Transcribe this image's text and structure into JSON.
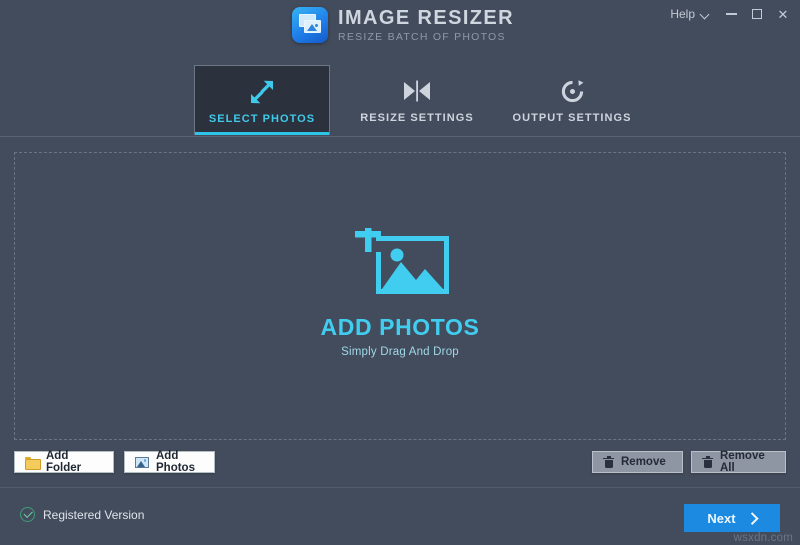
{
  "window": {
    "app_title": "IMAGE RESIZER",
    "app_subtitle": "RESIZE BATCH OF PHOTOS",
    "logo_icon": "image-stack-icon",
    "help_label": "Help",
    "help_chevron_icon": "chevron-down-icon",
    "minimize_icon": "minimize-icon",
    "maximize_icon": "maximize-icon",
    "close_icon": "close-icon",
    "close_glyph": "✕"
  },
  "tabs": [
    {
      "label": "SELECT PHOTOS",
      "icon": "resize-arrows-icon",
      "active": true
    },
    {
      "label": "RESIZE SETTINGS",
      "icon": "compress-width-icon",
      "active": false
    },
    {
      "label": "OUTPUT SETTINGS",
      "icon": "rotate-refresh-icon",
      "active": false
    }
  ],
  "dropzone": {
    "icon": "add-photo-frame-icon",
    "title": "ADD PHOTOS",
    "subtitle": "Simply Drag And Drop"
  },
  "actions": {
    "add_folder": {
      "label": "Add Folder",
      "icon": "folder-icon"
    },
    "add_photos": {
      "label": "Add Photos",
      "icon": "photo-icon"
    },
    "remove": {
      "label": "Remove",
      "icon": "trash-icon"
    },
    "remove_all": {
      "label": "Remove All",
      "icon": "trash-icon"
    }
  },
  "footer": {
    "registration_status": "Registered Version",
    "registration_icon": "check-circle-icon",
    "next_label": "Next",
    "next_icon": "chevron-right-icon",
    "watermark": "wsxdn.com"
  },
  "colors": {
    "window_background": "#434c5c",
    "active_tab_background": "#2c323d",
    "accent_cyan": "#3fc9ea",
    "accent_blue": "#1b8ae0",
    "dropzone_title": "#41cdef",
    "registered_green": "#3f9e78"
  }
}
